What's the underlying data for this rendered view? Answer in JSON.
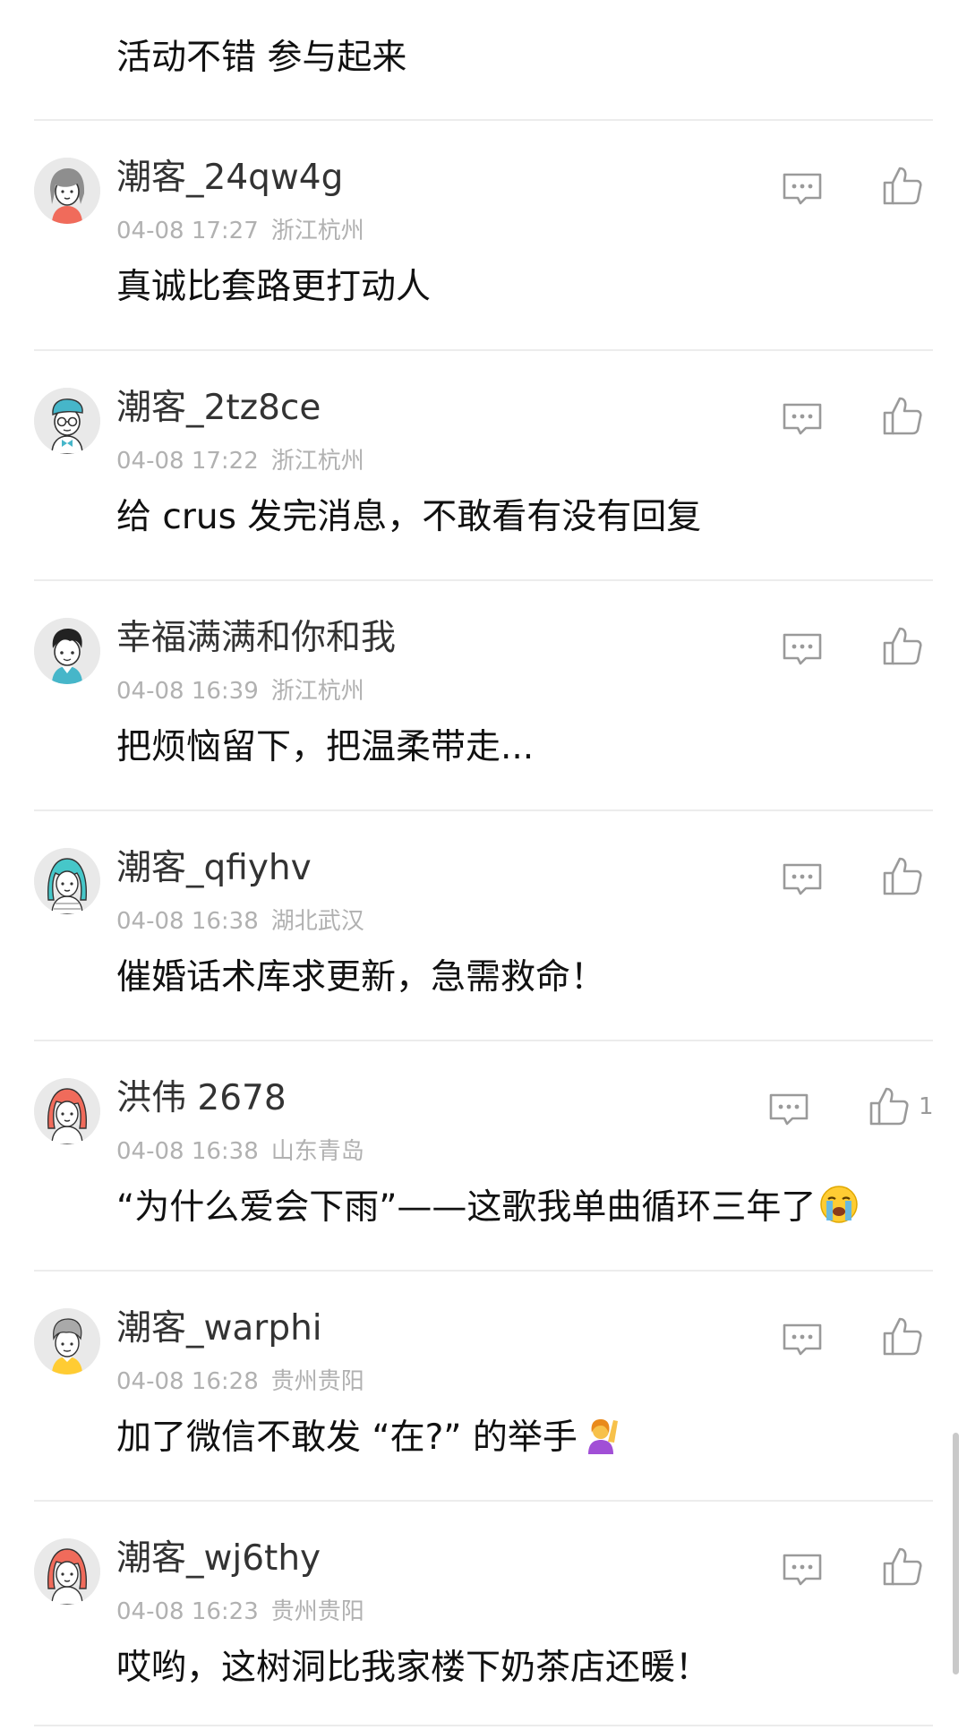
{
  "top_comment_text": "活动不错 参与起来",
  "colors": {
    "text": "#111111",
    "username": "#333333",
    "meta": "#b1b1b1",
    "divider": "#ececec",
    "icon": "#9a9a9a"
  },
  "icons": {
    "reply": "comment-bubble-icon",
    "like": "thumbs-up-icon"
  },
  "comments": [
    {
      "username": "潮客_24qw4g",
      "time": "04-08 17:27",
      "location": "浙江杭州",
      "text": "真诚比套路更打动人",
      "avatar": "grey-hair-avatar",
      "like_count": ""
    },
    {
      "username": "潮客_2tz8ce",
      "time": "04-08 17:22",
      "location": "浙江杭州",
      "text": "给 crus 发完消息，不敢看有没有回复",
      "avatar": "glasses-bowtie-avatar",
      "like_count": ""
    },
    {
      "username": "幸福满满和你和我",
      "time": "04-08 16:39",
      "location": "浙江杭州",
      "text": "把烦恼留下，把温柔带走...",
      "avatar": "boy-avatar",
      "like_count": ""
    },
    {
      "username": "潮客_qfiyhv",
      "time": "04-08 16:38",
      "location": "湖北武汉",
      "text": "催婚话术库求更新，急需救命！",
      "avatar": "teal-girl-avatar",
      "like_count": ""
    },
    {
      "username": "洪伟 2678",
      "time": "04-08 16:38",
      "location": "山东青岛",
      "text": "“为什么爱会下雨”——这歌我单曲循环三年了",
      "avatar": "red-hair-girl-avatar",
      "like_count": "1",
      "emoji": "loudly-crying-face-emoji"
    },
    {
      "username": "潮客_warphi",
      "time": "04-08 16:28",
      "location": "贵州贵阳",
      "text": "加了微信不敢发 “在?” 的举手",
      "avatar": "grey-hair-man-avatar",
      "like_count": "",
      "emoji": "person-raising-hand-emoji"
    },
    {
      "username": "潮客_wj6thy",
      "time": "04-08 16:23",
      "location": "贵州贵阳",
      "text": "哎哟，这树洞比我家楼下奶茶店还暖！",
      "avatar": "red-hair-girl-avatar",
      "like_count": ""
    }
  ]
}
